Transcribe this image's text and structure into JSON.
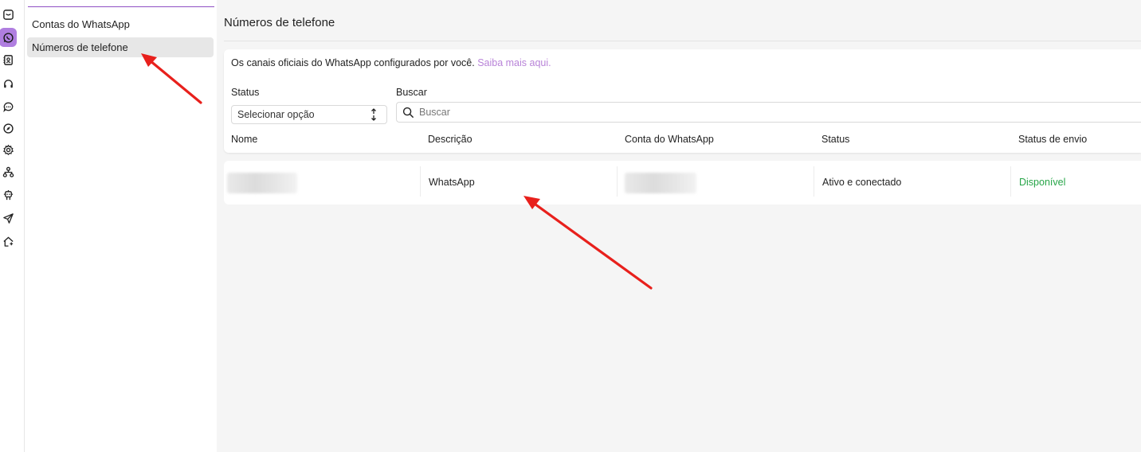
{
  "colors": {
    "accent": "#b07ee0",
    "link": "#b883d8",
    "success": "#27a548",
    "annotation_arrow": "#e8201c"
  },
  "rail": {
    "icons": [
      "inbox-icon",
      "whatsapp-icon",
      "contacts-icon",
      "headset-icon",
      "chat-icon",
      "compass-icon",
      "settings-icon",
      "network-icon",
      "bot-icon",
      "send-icon",
      "home-icon"
    ],
    "active_icon": "whatsapp-icon"
  },
  "sidebar": {
    "items": [
      {
        "label": "Contas do WhatsApp",
        "selected": false
      },
      {
        "label": "Números de telefone",
        "selected": true
      }
    ]
  },
  "main": {
    "title": "Números de telefone",
    "info_text": "Os canais oficiais do WhatsApp configurados por você.",
    "info_link": "Saiba mais aqui.",
    "filters": {
      "status_label": "Status",
      "status_value": "Selecionar opção",
      "search_label": "Buscar",
      "search_placeholder": "Buscar"
    },
    "table": {
      "columns": [
        "Nome",
        "Descrição",
        "Conta do WhatsApp",
        "Status",
        "Status de envio"
      ],
      "rows": [
        {
          "nome": "",
          "descricao": "WhatsApp",
          "conta": "",
          "status": "Ativo e conectado",
          "status_envio": "Disponível"
        }
      ]
    }
  }
}
